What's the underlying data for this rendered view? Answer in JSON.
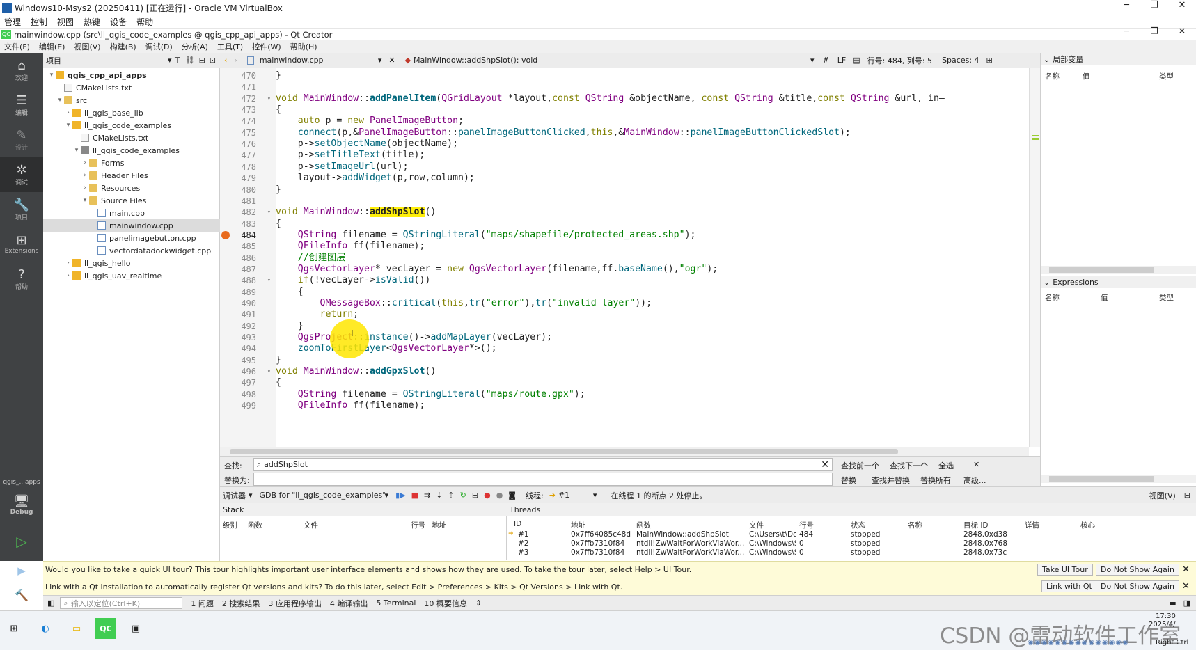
{
  "vbox": {
    "title": "Windows10-Msys2 (20250411) [正在运行] - Oracle VM VirtualBox",
    "menu": [
      "管理",
      "控制",
      "视图",
      "热键",
      "设备",
      "帮助"
    ]
  },
  "qc": {
    "title": "mainwindow.cpp (src\\ll_qgis_code_examples @ qgis_cpp_api_apps) - Qt Creator",
    "menu": [
      "文件(F)",
      "编辑(E)",
      "视图(V)",
      "构建(B)",
      "调试(D)",
      "分析(A)",
      "工具(T)",
      "控件(W)",
      "帮助(H)"
    ]
  },
  "modes": [
    {
      "icon": "home-icon",
      "label": "欢迎"
    },
    {
      "icon": "edit-icon",
      "label": "编辑"
    },
    {
      "icon": "design-icon",
      "label": "设计"
    },
    {
      "icon": "debug-icon",
      "label": "调试"
    },
    {
      "icon": "wrench-icon",
      "label": "项目"
    },
    {
      "icon": "extensions-icon",
      "label": "Extensions"
    },
    {
      "icon": "help-icon",
      "label": "帮助"
    }
  ],
  "kit": {
    "name": "qgis_...apps",
    "mode": "Debug"
  },
  "project_panel": {
    "title": "项目"
  },
  "tree": [
    {
      "label": "qgis_cpp_api_apps",
      "indent": 0,
      "arrow": "▾",
      "icon": "f-proj",
      "bold": true
    },
    {
      "label": "CMakeLists.txt",
      "indent": 1,
      "arrow": "",
      "icon": "f-cmake"
    },
    {
      "label": "src",
      "indent": 1,
      "arrow": "▾",
      "icon": "f-folder"
    },
    {
      "label": "ll_qgis_base_lib",
      "indent": 2,
      "arrow": "›",
      "icon": "f-proj"
    },
    {
      "label": "ll_qgis_code_examples",
      "indent": 2,
      "arrow": "▾",
      "icon": "f-proj"
    },
    {
      "label": "CMakeLists.txt",
      "indent": 3,
      "arrow": "",
      "icon": "f-cmake"
    },
    {
      "label": "ll_qgis_code_examples",
      "indent": 3,
      "arrow": "▾",
      "icon": "f-tool"
    },
    {
      "label": "Forms",
      "indent": 4,
      "arrow": "›",
      "icon": "f-folder"
    },
    {
      "label": "Header Files",
      "indent": 4,
      "arrow": "›",
      "icon": "f-folder"
    },
    {
      "label": "Resources",
      "indent": 4,
      "arrow": "›",
      "icon": "f-folder"
    },
    {
      "label": "Source Files",
      "indent": 4,
      "arrow": "▾",
      "icon": "f-folder"
    },
    {
      "label": "main.cpp",
      "indent": 5,
      "arrow": "",
      "icon": "f-file"
    },
    {
      "label": "mainwindow.cpp",
      "indent": 5,
      "arrow": "",
      "icon": "f-file",
      "selected": true
    },
    {
      "label": "panelimagebutton.cpp",
      "indent": 5,
      "arrow": "",
      "icon": "f-file"
    },
    {
      "label": "vectordatadockwidget.cpp",
      "indent": 5,
      "arrow": "",
      "icon": "f-file"
    },
    {
      "label": "ll_qgis_hello",
      "indent": 2,
      "arrow": "›",
      "icon": "f-proj"
    },
    {
      "label": "ll_qgis_uav_realtime",
      "indent": 2,
      "arrow": "›",
      "icon": "f-proj"
    }
  ],
  "editor": {
    "file": "mainwindow.cpp",
    "symbol": "MainWindow::addShpSlot(): void",
    "hash": "#",
    "eol": "LF",
    "position": "行号: 484, 列号: 5",
    "spaces": "Spaces: 4"
  },
  "code": [
    {
      "n": "470",
      "html": "}"
    },
    {
      "n": "471",
      "html": ""
    },
    {
      "n": "472",
      "fold": true,
      "html": "<span class='kw'>void</span> <span class='ty'>MainWindow</span>::<span class='bold'>addPanelItem</span>(<span class='ty'>QGridLayout</span> *layout,<span class='kw'>const</span> <span class='ty'>QString</span> &amp;objectName, <span class='kw'>const</span> <span class='ty'>QString</span> &amp;title,<span class='kw'>const</span> <span class='ty'>QString</span> &amp;url, in—"
    },
    {
      "n": "473",
      "html": "{"
    },
    {
      "n": "474",
      "html": "    <span class='kw'>auto</span> p = <span class='kw'>new</span> <span class='ty'>PanelImageButton</span>;"
    },
    {
      "n": "475",
      "html": "    <span class='fn'>connect</span>(p,&amp;<span class='ty'>PanelImageButton</span>::<span class='fn'>panelImageButtonClicked</span>,<span class='kw'>this</span>,&amp;<span class='ty'>MainWindow</span>::<span class='fn'>panelImageButtonClickedSlot</span>);"
    },
    {
      "n": "476",
      "html": "    p-&gt;<span class='fn'>setObjectName</span>(objectName);"
    },
    {
      "n": "477",
      "html": "    p-&gt;<span class='fn'>setTitleText</span>(title);"
    },
    {
      "n": "478",
      "html": "    p-&gt;<span class='fn'>setImageUrl</span>(url);"
    },
    {
      "n": "479",
      "html": "    layout-&gt;<span class='fn'>addWidget</span>(p,row,column);"
    },
    {
      "n": "480",
      "html": "}"
    },
    {
      "n": "481",
      "html": ""
    },
    {
      "n": "482",
      "fold": true,
      "html": "<span class='kw'>void</span> <span class='ty'>MainWindow</span>::<span class='hl'>addShpSlot</span>()"
    },
    {
      "n": "483",
      "html": "{"
    },
    {
      "n": "484",
      "bp": true,
      "html": "    <span class='ty'>QString</span> filename = <span class='fn'>QStringLiteral</span>(<span class='st'>\"maps/shapefile/protected_areas.shp\"</span>);"
    },
    {
      "n": "485",
      "html": "    <span class='ty'>QFileInfo</span> ff(filename);"
    },
    {
      "n": "486",
      "html": "    <span class='cm'>//创建图层</span>"
    },
    {
      "n": "487",
      "html": "    <span class='ty'>QgsVectorLayer</span>* vecLayer = <span class='kw'>new</span> <span class='ty'>QgsVectorLayer</span>(filename,ff.<span class='fn'>baseName</span>(),<span class='st'>\"ogr\"</span>);"
    },
    {
      "n": "488",
      "fold": true,
      "html": "    <span class='kw'>if</span>(!vecLayer-&gt;<span class='fn'>isValid</span>())"
    },
    {
      "n": "489",
      "html": "    {"
    },
    {
      "n": "490",
      "html": "        <span class='ty'>QMessageBox</span>::<span class='fn'>critical</span>(<span class='kw'>this</span>,<span class='fn'>tr</span>(<span class='st'>\"error\"</span>),<span class='fn'>tr</span>(<span class='st'>\"invalid layer\"</span>));"
    },
    {
      "n": "491",
      "html": "        <span class='kw'>return</span>;"
    },
    {
      "n": "492",
      "html": "    }"
    },
    {
      "n": "493",
      "html": "    <span class='ty'>QgsProject</span>::<span class='fn'>instance</span>()-&gt;<span class='fn'>addMapLayer</span>(vecLayer);"
    },
    {
      "n": "494",
      "html": "    <span class='fn'>zoomToFirstLayer</span>&lt;<span class='ty'>QgsVectorLayer</span>*&gt;();"
    },
    {
      "n": "495",
      "html": "}"
    },
    {
      "n": "496",
      "fold": true,
      "html": "<span class='kw'>void</span> <span class='ty'>MainWindow</span>::<span class='bold'>addGpxSlot</span>()"
    },
    {
      "n": "497",
      "html": "{"
    },
    {
      "n": "498",
      "html": "    <span class='ty'>QString</span> filename = <span class='fn'>QStringLiteral</span>(<span class='st'>\"maps/route.gpx\"</span>);"
    },
    {
      "n": "499",
      "html": "    <span class='ty'>QFileInfo</span> ff(filename);"
    }
  ],
  "find": {
    "find_label": "查找:",
    "replace_label": "替换为:",
    "find_value": "addShpSlot",
    "btn_find_prev": "查找前一个",
    "btn_find_next": "查找下一个",
    "btn_all": "全选",
    "btn_replace": "替换",
    "btn_find_replace": "查找并替换",
    "btn_replace_all": "替换所有",
    "btn_advanced": "高级..."
  },
  "debugbar": {
    "label": "调试器",
    "engine": "GDB for \"ll_qgis_code_examples\"",
    "thread_label": "线程:",
    "thread_value": "#1",
    "status": "在线程 1 的断点 2 处停止。",
    "views": "视图(V)"
  },
  "stack": {
    "title": "Stack",
    "columns": [
      "级别",
      "函数",
      "文件",
      "行号",
      "地址"
    ]
  },
  "threads": {
    "title": "Threads",
    "columns": [
      "ID",
      "地址",
      "函数",
      "文件",
      "行号",
      "状态",
      "名称",
      "目标 ID",
      "详情",
      "核心"
    ],
    "rows": [
      {
        "id": "#1",
        "addr": "0x7ff64085c48d",
        "func": "MainWindow::addShpSlot",
        "file": "C:\\Users\\t\\Do...",
        "line": "484",
        "state": "stopped",
        "target": "2848.0xd38"
      },
      {
        "id": "#2",
        "addr": "0x7ffb7310f84",
        "func": "ntdll!ZwWaitForWorkViaWor...",
        "file": "C:\\Windows\\S...",
        "line": "0",
        "state": "stopped",
        "target": "2848.0x768"
      },
      {
        "id": "#3",
        "addr": "0x7ffb7310f84",
        "func": "ntdll!ZwWaitForWorkViaWor...",
        "file": "C:\\Windows\\S...",
        "line": "0",
        "state": "stopped",
        "target": "2848.0x73c"
      }
    ]
  },
  "locals": {
    "title": "局部变量",
    "columns": [
      "名称",
      "值",
      "类型"
    ]
  },
  "expressions": {
    "title": "Expressions",
    "columns": [
      "名称",
      "值",
      "类型"
    ]
  },
  "tour": {
    "text": "Would you like to take a quick UI tour? This tour highlights important user interface elements and shows how they are used. To take the tour later, select Help > UI Tour.",
    "btn_take": "Take UI Tour",
    "btn_dismiss": "Do Not Show Again"
  },
  "link": {
    "text": "Link with a Qt installation to automatically register Qt versions and kits? To do this later, select Edit > Preferences > Kits > Qt Versions > Link with Qt.",
    "btn_link": "Link with Qt",
    "btn_dismiss": "Do Not Show Again"
  },
  "status": {
    "locator_placeholder": "输入以定位(Ctrl+K)",
    "tabs": [
      "1 问题",
      "2 搜索结果",
      "3 应用程序输出",
      "4 编译输出",
      "5 Terminal",
      "10 概要信息"
    ]
  },
  "taskbar": {
    "watermark": "CSDN @雷动软件工作室",
    "time": "17:30",
    "date": "2025/4/",
    "right_ctrl": "Right Ctrl"
  },
  "colors": {
    "modebar": "#404244",
    "highlight": "#ffef0b",
    "breakpoint": "#e86a1c"
  }
}
